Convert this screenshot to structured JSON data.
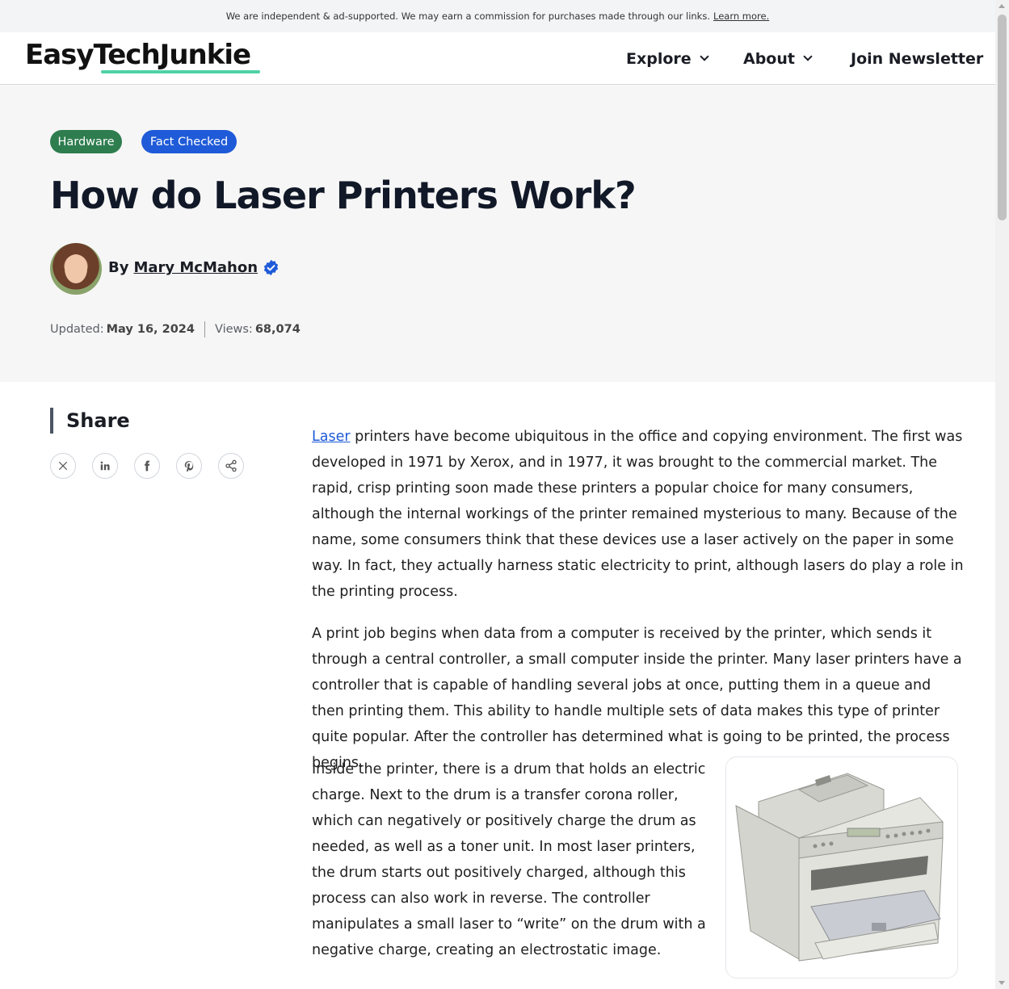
{
  "topbar": {
    "notice": "We are independent & ad-supported. We may earn a commission for purchases made through our links.",
    "learn_more": "Learn more."
  },
  "header": {
    "logo": "EasyTechJunkie",
    "nav": [
      {
        "label": "Explore",
        "has_dropdown": true
      },
      {
        "label": "About",
        "has_dropdown": true
      },
      {
        "label": "Join Newsletter",
        "has_dropdown": false
      }
    ]
  },
  "hero": {
    "tags": [
      "Hardware",
      "Fact Checked"
    ],
    "title": "How do Laser Printers Work?",
    "by_label": "By",
    "author": "Mary McMahon",
    "updated_label": "Updated:",
    "updated_date": "May 16, 2024",
    "views_label": "Views:",
    "views": "68,074"
  },
  "share": {
    "title": "Share",
    "buttons": [
      "x-icon",
      "linkedin-icon",
      "facebook-icon",
      "pinterest-icon",
      "share-icon"
    ]
  },
  "article": {
    "p1_link": "Laser",
    "p1_rest": " printers have become ubiquitous in the office and copying environment. The first was developed in 1971 by Xerox, and in 1977, it was brought to the commercial market. The rapid, crisp printing soon made these printers a popular choice for many consumers, although the internal workings of the printer remained mysterious to many. Because of the name, some consumers think that these devices use a laser actively on the paper in some way. In fact, they actually harness static electricity to print, although lasers do play a role in the printing process.",
    "p2": "A print job begins when data from a computer is received by the printer, which sends it through a central controller, a small computer inside the printer. Many laser printers have a controller that is capable of handling several jobs at once, putting them in a queue and then printing them. This ability to handle multiple sets of data makes this type of printer quite popular. After the controller has determined what is going to be printed, the process begins.",
    "p3": "Inside the printer, there is a drum that holds an electric charge. Next to the drum is a transfer corona roller, which can negatively or positively charge the drum as needed, as well as a toner unit. In most laser printers, the drum starts out positively charged, although this process can also work in reverse. The controller manipulates a small laser to “write” on the drum with a negative charge, creating an electrostatic image."
  },
  "colors": {
    "accent_green": "#4fd1a5",
    "tag_hardware": "#2e7d4f",
    "tag_fact_checked": "#1f5bd8",
    "link": "#1f5bd8"
  }
}
